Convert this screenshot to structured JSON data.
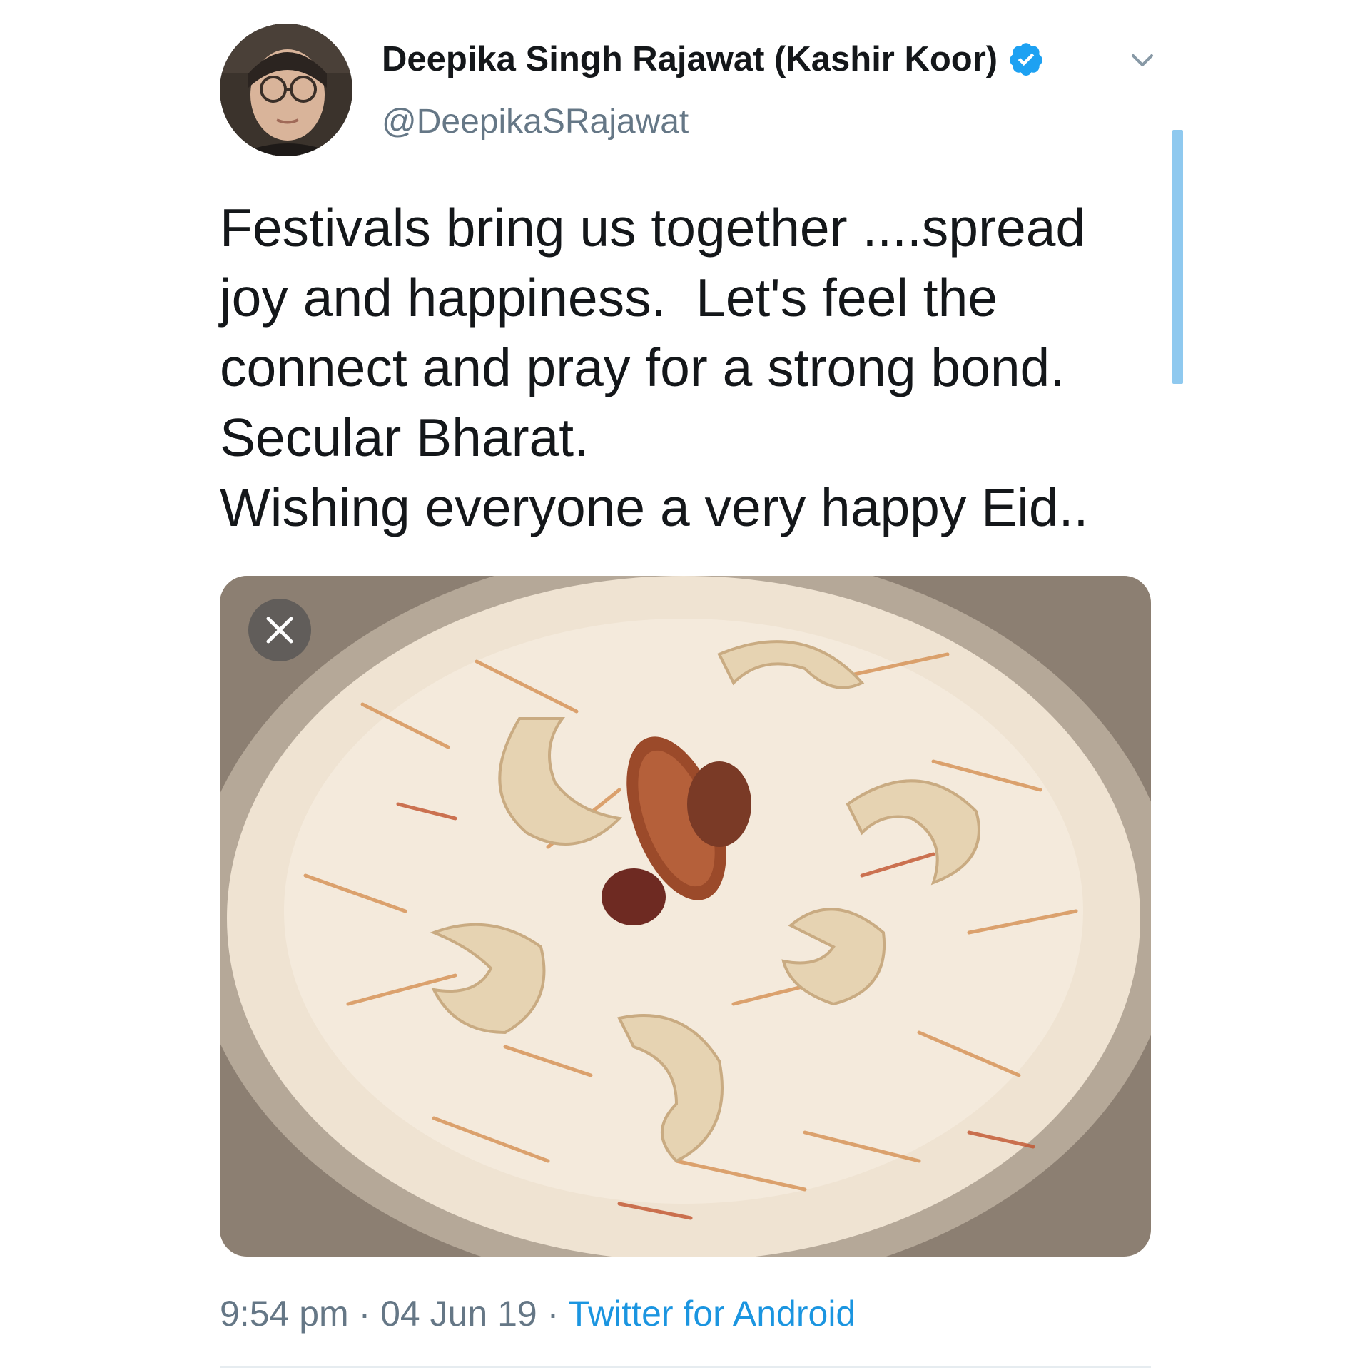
{
  "tweet": {
    "author": {
      "display_name": "Deepika Singh Rajawat (Kashir Koor)",
      "handle": "@DeepikaSRajawat",
      "verified": true,
      "verified_icon": "verified-badge-icon"
    },
    "menu_icon": "chevron-down-icon",
    "text_lines": [
      "Festivals bring us together ....spread",
      "joy and happiness.  Let's feel the",
      "connect and pray for a strong bond.",
      "Secular Bharat.",
      "Wishing everyone a very happy Eid.."
    ],
    "media": {
      "close_icon": "close-icon"
    },
    "meta": {
      "time": "9:54 pm",
      "separator": " · ",
      "date": "04 Jun 19",
      "source": "Twitter for Android"
    }
  },
  "colors": {
    "text": "#14171a",
    "secondary": "#657786",
    "link": "#1b95e0",
    "verified": "#1da1f2",
    "scrollbar": "#8fc9ef"
  }
}
